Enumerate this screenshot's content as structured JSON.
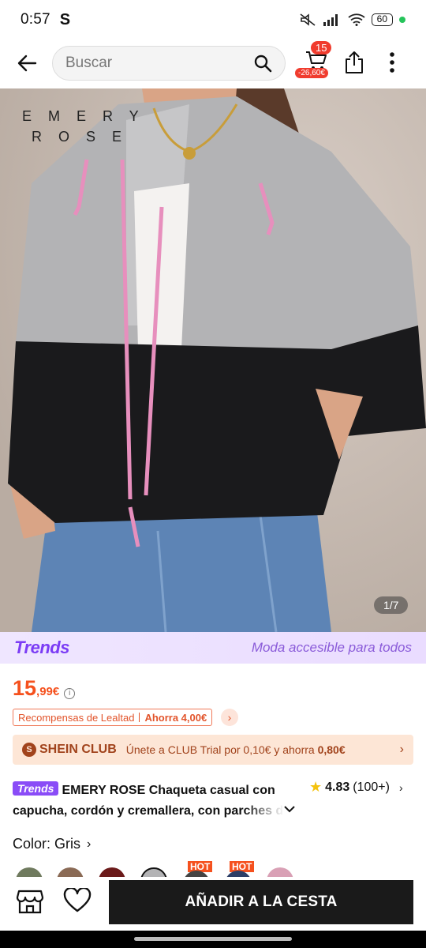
{
  "status_bar": {
    "time": "0:57",
    "app_indicator": "S",
    "battery": "60"
  },
  "header": {
    "search_placeholder": "Buscar",
    "cart_count": "15",
    "cart_discount": "-26,60€",
    "icons": [
      "back-arrow-icon",
      "search-icon",
      "cart-icon",
      "share-icon",
      "more-icon"
    ]
  },
  "product_image": {
    "brand_logo_line1": "E M E R Y",
    "brand_logo_line2": "R O S E",
    "page_indicator": "1/7"
  },
  "trends_banner": {
    "logo": "Trends",
    "tagline": "Moda accesible para todos"
  },
  "price": {
    "main": "15",
    "cents": ",99€",
    "info_icon": "info-icon"
  },
  "loyalty": {
    "label": "Recompensas de Lealtad",
    "savings": "Ahorra 4,00€"
  },
  "club": {
    "brand": "SHEIN CLUB",
    "offer_text": "Únete a CLUB Trial por 0,10€ y ahorra",
    "offer_amount": "0,80€"
  },
  "product": {
    "trends_chip": "Trends",
    "title_line1": "EMERY ROSE Chaqueta casual con",
    "title_line2": "capucha, cordón y cremallera, con parches de",
    "rating": "4.83",
    "review_count": "(100+)"
  },
  "color": {
    "label": "Color: Gris",
    "hot_badge_1": "HOT",
    "hot_badge_2": "HOT"
  },
  "bottom_bar": {
    "add_to_cart": "AÑADIR A LA CESTA"
  },
  "colors": {
    "accent": "#f5511e",
    "trends_purple": "#7b3cf5",
    "cta_bg": "#1a1a1a"
  }
}
